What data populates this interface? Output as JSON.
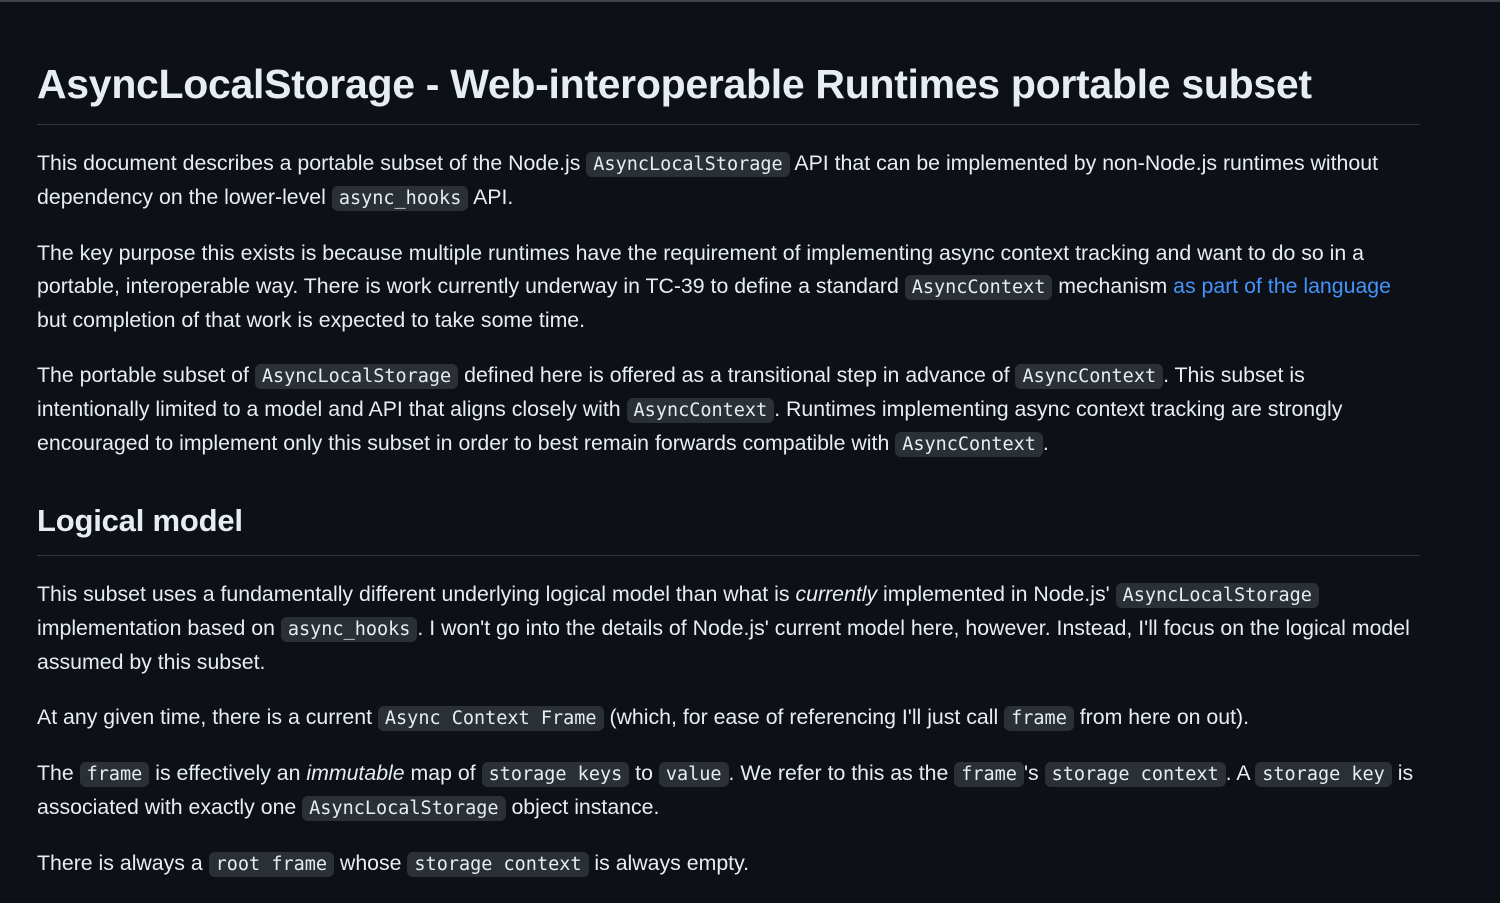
{
  "h1": "AsyncLocalStorage - Web-interoperable Runtimes portable subset",
  "p1": {
    "t1": "This document describes a portable subset of the Node.js ",
    "c1": "AsyncLocalStorage",
    "t2": " API that can be implemented by non-Node.js runtimes without dependency on the lower-level ",
    "c2": "async_hooks",
    "t3": " API."
  },
  "p2": {
    "t1": "The key purpose this exists is because multiple runtimes have the requirement of implementing async context tracking and want to do so in a portable, interoperable way. There is work currently underway in TC-39 to define a standard ",
    "c1": "AsyncContext",
    "t2": " mechanism ",
    "link": "as part of the language",
    "t3": " but completion of that work is expected to take some time."
  },
  "p3": {
    "t1": "The portable subset of ",
    "c1": "AsyncLocalStorage",
    "t2": " defined here is offered as a transitional step in advance of ",
    "c2": "AsyncContext",
    "t3": ". This subset is intentionally limited to a model and API that aligns closely with ",
    "c3": "AsyncContext",
    "t4": ". Runtimes implementing async context tracking are strongly encouraged to implement only this subset in order to best remain forwards compatible with ",
    "c4": "AsyncContext",
    "t5": "."
  },
  "h2": "Logical model",
  "p4": {
    "t1": "This subset uses a fundamentally different underlying logical model than what is ",
    "em": "currently",
    "t2": " implemented in Node.js' ",
    "c1": "AsyncLocalStorage",
    "t3": " implementation based on ",
    "c2": "async_hooks",
    "t4": ". I won't go into the details of Node.js' current model here, however. Instead, I'll focus on the logical model assumed by this subset."
  },
  "p5": {
    "t1": "At any given time, there is a current ",
    "c1": "Async Context Frame",
    "t2": " (which, for ease of referencing I'll just call ",
    "c2": "frame",
    "t3": " from here on out)."
  },
  "p6": {
    "t1": "The ",
    "c1": "frame",
    "t2": " is effectively an ",
    "em": "immutable",
    "t3": " map of ",
    "c2": "storage keys",
    "t4": " to ",
    "c3": "value",
    "t5": ". We refer to this as the ",
    "c4": "frame",
    "t6": "'s ",
    "c5": "storage context",
    "t7": ". A ",
    "c6": "storage key",
    "t8": " is associated with exactly one ",
    "c7": "AsyncLocalStorage",
    "t9": " object instance."
  },
  "p7": {
    "t1": "There is always a ",
    "c1": "root frame",
    "t2": " whose ",
    "c2": "storage context",
    "t3": " is always empty."
  }
}
